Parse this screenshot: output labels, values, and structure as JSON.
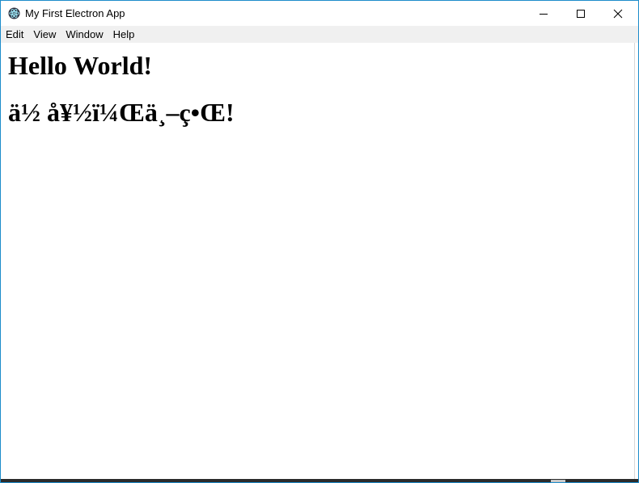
{
  "window": {
    "title": "My First Electron App",
    "icon": "electron-atom-icon",
    "accent_color": "#1d8ccb"
  },
  "controls": {
    "minimize_icon": "minimize-icon",
    "maximize_icon": "maximize-icon",
    "close_icon": "close-icon"
  },
  "menu": {
    "items": [
      {
        "label": "Edit"
      },
      {
        "label": "View"
      },
      {
        "label": "Window"
      },
      {
        "label": "Help"
      }
    ]
  },
  "content": {
    "heading1": "Hello World!",
    "heading2": "ä½ å¥½ï¼Œä¸–ç•Œ!"
  }
}
